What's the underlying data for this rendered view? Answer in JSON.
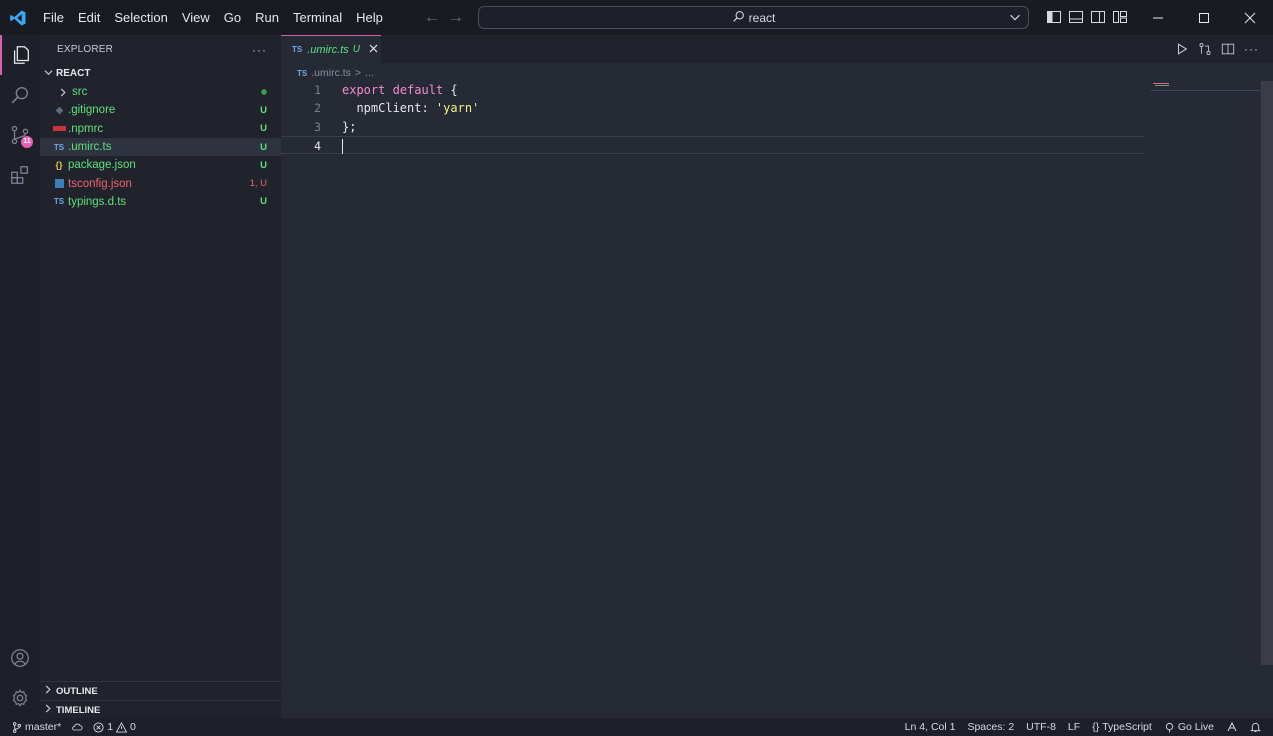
{
  "titlebar": {
    "menu": [
      "File",
      "Edit",
      "Selection",
      "View",
      "Go",
      "Run",
      "Terminal",
      "Help"
    ],
    "search_text": "react"
  },
  "activitybar": {
    "scm_badge": "11"
  },
  "explorer": {
    "title": "EXPLORER",
    "more": "···",
    "root": "REACT",
    "items": [
      {
        "name": "src",
        "badge": ""
      },
      {
        "name": ".gitignore",
        "badge": "U"
      },
      {
        "name": ".npmrc",
        "badge": "U"
      },
      {
        "name": ".umirc.ts",
        "badge": "U"
      },
      {
        "name": "package.json",
        "badge": "U"
      },
      {
        "name": "tsconfig.json",
        "badge": "1, U"
      },
      {
        "name": "typings.d.ts",
        "badge": "U"
      }
    ],
    "outline": "OUTLINE",
    "timeline": "TIMELINE"
  },
  "editor": {
    "tab": {
      "lang": "TS",
      "name": ".umirc.ts",
      "modified": "U"
    },
    "breadcrumb": {
      "lang": "TS",
      "file": ".umirc.ts",
      "sep": ">",
      "more": "..."
    },
    "lines": [
      "1",
      "2",
      "3",
      "4"
    ],
    "code": {
      "kw_export": "export",
      "kw_default": "default",
      "brace_open": " {",
      "prop": "  npmClient: ",
      "value": "'yarn'",
      "brace_close": "};"
    }
  },
  "status": {
    "branch": "master*",
    "errors": "1",
    "warnings": "0",
    "position": "Ln 4, Col 1",
    "spaces": "Spaces: 2",
    "encoding": "UTF-8",
    "eol": "LF",
    "language": "TypeScript",
    "golive": "Go Live"
  },
  "colors": {
    "accent": "#d75fab",
    "untracked": "#5ee07a",
    "error": "#f0616d",
    "keyword": "#f28ad0",
    "string": "#f1f08a"
  }
}
